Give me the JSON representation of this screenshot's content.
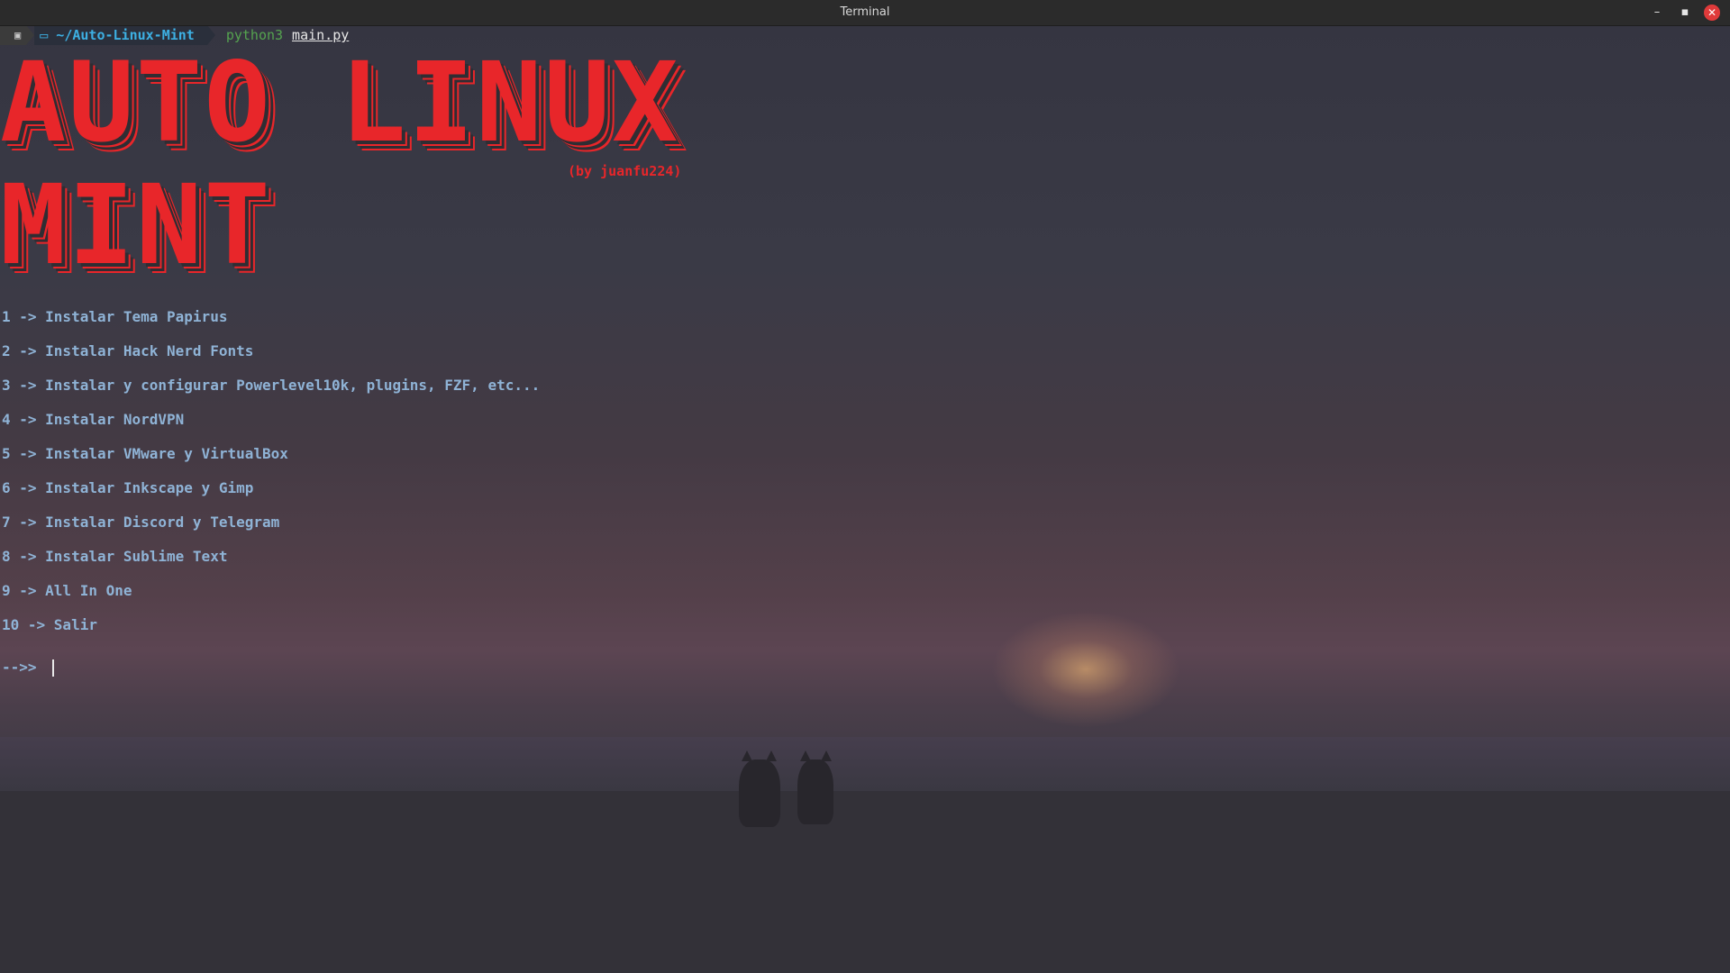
{
  "window": {
    "title": "Terminal",
    "controls": {
      "minimize_glyph": "–",
      "maximize_glyph": "▪",
      "close_glyph": "✕"
    }
  },
  "prompt": {
    "os_icon": "▣",
    "dir_icon": "▭",
    "directory": "~/Auto-Linux-Mint",
    "command": "python3",
    "argument": "main.py"
  },
  "banner": {
    "line1": "AUTO LINUX",
    "line2": "MINT",
    "byline": "(by juanfu224)",
    "color": "#e8262a"
  },
  "menu": {
    "items": [
      "1 -> Instalar Tema Papirus",
      "2 -> Instalar Hack Nerd Fonts",
      "3 -> Instalar y configurar Powerlevel10k, plugins, FZF, etc...",
      "4 -> Instalar NordVPN",
      "5 -> Instalar VMware y VirtualBox",
      "6 -> Instalar Inkscape y Gimp",
      "7 -> Instalar Discord y Telegram",
      "8 -> Instalar Sublime Text",
      "9 -> All In One",
      "10 -> Salir"
    ],
    "color": "#8fb3d6"
  },
  "input": {
    "prompt": "-->>",
    "value": ""
  }
}
